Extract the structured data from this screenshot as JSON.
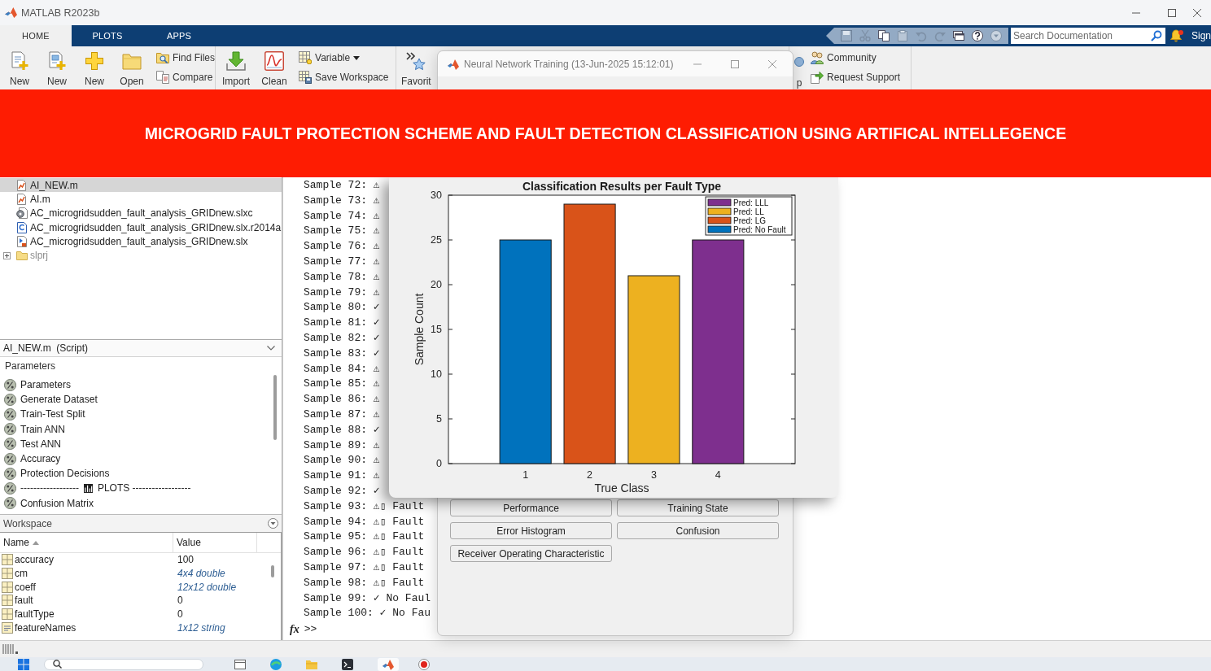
{
  "window": {
    "title": "MATLAB R2023b"
  },
  "tabs": [
    {
      "label": "HOME",
      "selected": true
    },
    {
      "label": "PLOTS",
      "selected": false
    },
    {
      "label": "APPS",
      "selected": false
    }
  ],
  "search": {
    "placeholder": "Search Documentation"
  },
  "notifications": {
    "unread": true
  },
  "account": {
    "label": "Sign"
  },
  "ribbon": {
    "groups": [
      {
        "items": [
          {
            "kind": "large",
            "label": "New"
          },
          {
            "kind": "large",
            "label": "New"
          },
          {
            "kind": "large",
            "label": "New"
          },
          {
            "kind": "large",
            "label": "Open"
          },
          {
            "kind": "stack",
            "items": [
              {
                "label": "Find Files",
                "menu": false
              },
              {
                "label": "Compare",
                "menu": false
              }
            ]
          }
        ]
      },
      {
        "items": [
          {
            "kind": "large",
            "label": "Import"
          },
          {
            "kind": "large",
            "label": "Clean"
          },
          {
            "kind": "stack",
            "items": [
              {
                "label": "Variable",
                "menu": true
              },
              {
                "label": "Save Workspace",
                "menu": false
              }
            ]
          }
        ]
      },
      {
        "items": [
          {
            "kind": "large",
            "label": "Favorit"
          }
        ]
      },
      {
        "items": [
          {
            "kind": "large",
            "label": "p"
          },
          {
            "kind": "stack",
            "items": [
              {
                "label": "Community",
                "menu": false
              },
              {
                "label": "Request Support",
                "menu": false
              }
            ]
          }
        ]
      }
    ]
  },
  "banner": {
    "text": "MICROGRID FAULT PROTECTION SCHEME AND FAULT DETECTION CLASSIFICATION USING ARTIFICAL INTELLEGENCE"
  },
  "current_folder": {
    "items": [
      {
        "name": "AI_NEW.m",
        "kind": "script",
        "selected": true,
        "greyed": false
      },
      {
        "name": "AI.m",
        "kind": "script",
        "selected": false,
        "greyed": false
      },
      {
        "name": "AC_microgridsudden_fault_analysis_GRIDnew.slxc",
        "kind": "cache",
        "selected": false,
        "greyed": false
      },
      {
        "name": "AC_microgridsudden_fault_analysis_GRIDnew.slx.r2014a",
        "kind": "backup",
        "selected": false,
        "greyed": false
      },
      {
        "name": "AC_microgridsudden_fault_analysis_GRIDnew.slx",
        "kind": "model",
        "selected": false,
        "greyed": false
      },
      {
        "name": "slprj",
        "kind": "folder",
        "selected": false,
        "greyed": true,
        "expanded": false
      }
    ]
  },
  "details": {
    "title": "AI_NEW.m  (Script)",
    "description": "Parameters",
    "sections": [
      {
        "kind": "section",
        "label": "Parameters"
      },
      {
        "kind": "section",
        "label": "Generate Dataset"
      },
      {
        "kind": "section",
        "label": "Train-Test Split"
      },
      {
        "kind": "section",
        "label": "Train ANN"
      },
      {
        "kind": "section",
        "label": "Test ANN"
      },
      {
        "kind": "section",
        "label": "Accuracy"
      },
      {
        "kind": "section",
        "label": "Protection Decisions"
      },
      {
        "kind": "divider",
        "label": "------------------",
        "label_after": "PLOTS ------------------"
      },
      {
        "kind": "section",
        "label": "Confusion Matrix"
      }
    ]
  },
  "workspace": {
    "title": "Workspace",
    "columns": [
      {
        "label": "Name",
        "sorted": true
      },
      {
        "label": "Value",
        "sorted": false
      }
    ],
    "rows": [
      {
        "name": "accuracy",
        "value": "100",
        "kind": "numeric",
        "summary": false
      },
      {
        "name": "cm",
        "value": "4x4 double",
        "kind": "numeric",
        "summary": true
      },
      {
        "name": "coeff",
        "value": "12x12 double",
        "kind": "numeric",
        "summary": true
      },
      {
        "name": "fault",
        "value": "0",
        "kind": "numeric",
        "summary": false
      },
      {
        "name": "faultType",
        "value": "0",
        "kind": "numeric",
        "summary": false
      },
      {
        "name": "featureNames",
        "value": "1x12 string",
        "kind": "string",
        "summary": true
      }
    ]
  },
  "command_window": {
    "lines": [
      "Sample 72: ⚠",
      "Sample 73: ⚠",
      "Sample 74: ⚠",
      "Sample 75: ⚠",
      "Sample 76: ⚠",
      "Sample 77: ⚠",
      "Sample 78: ⚠",
      "Sample 79: ⚠",
      "Sample 80: ✓",
      "Sample 81: ✓",
      "Sample 82: ✓",
      "Sample 83: ✓",
      "Sample 84: ⚠",
      "Sample 85: ⚠",
      "Sample 86: ⚠",
      "Sample 87: ⚠",
      "Sample 88: ✓",
      "Sample 89: ⚠",
      "Sample 90: ⚠",
      "Sample 91: ⚠",
      "Sample 92: ✓",
      "Sample 93: ⚠▯ Fault",
      "Sample 94: ⚠▯ Fault",
      "Sample 95: ⚠▯ Fault",
      "Sample 96: ⚠▯ Fault",
      "Sample 97: ⚠▯ Fault",
      "Sample 98: ⚠▯ Fault",
      "Sample 99: ✓ No Faul",
      "Sample 100: ✓ No Fau"
    ],
    "function_button": "fx",
    "prompt": ">>"
  },
  "training_window": {
    "title": "Neural Network Training (13-Jun-2025 15:12:01)",
    "plot_buttons": [
      "Performance",
      "Training State",
      "Error Histogram",
      "Confusion",
      "Receiver Operating Characteristic"
    ]
  },
  "figure": {
    "chart_data": {
      "type": "bar",
      "title": "Classification Results per Fault Type",
      "xlabel": "True Class",
      "ylabel": "Sample Count",
      "categories": [
        "1",
        "2",
        "3",
        "4"
      ],
      "series": [
        {
          "name": "Pred: LLL",
          "color": "#7e2f8e",
          "values": [
            0,
            0,
            0,
            25
          ]
        },
        {
          "name": "Pred: LL",
          "color": "#edb120",
          "values": [
            0,
            0,
            21,
            0
          ]
        },
        {
          "name": "Pred: LG",
          "color": "#d95319",
          "values": [
            0,
            29,
            0,
            0
          ]
        },
        {
          "name": "Pred: No Fault",
          "color": "#0072bd",
          "values": [
            25,
            0,
            0,
            0
          ]
        }
      ],
      "ylim": [
        0,
        30
      ],
      "yticks": [
        {
          "value": 0,
          "label": "0"
        },
        {
          "value": 5,
          "label": "5"
        },
        {
          "value": 10,
          "label": "10"
        },
        {
          "value": 15,
          "label": "15"
        },
        {
          "value": 20,
          "label": "20"
        },
        {
          "value": 25,
          "label": "25"
        },
        {
          "value": 30,
          "label": "30"
        }
      ],
      "stacked": true,
      "legend": true
    }
  }
}
